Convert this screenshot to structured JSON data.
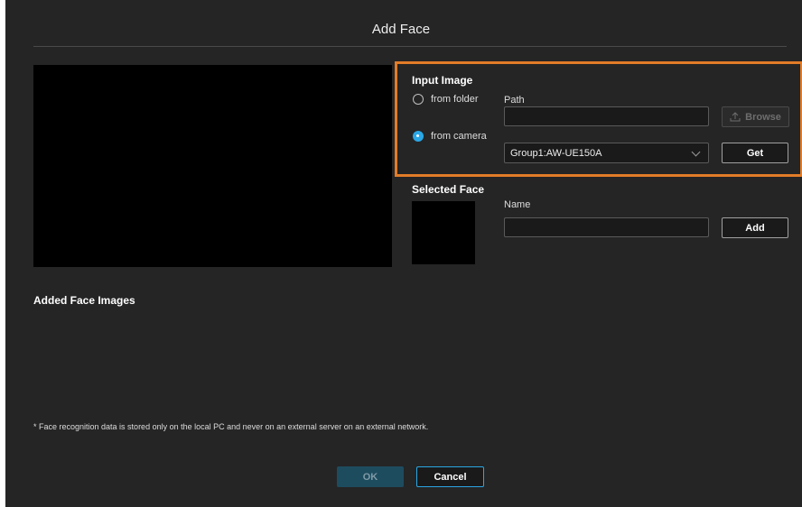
{
  "dialog": {
    "title": "Add Face"
  },
  "input_image": {
    "heading": "Input Image",
    "from_folder_label": "from folder",
    "from_camera_label": "from camera",
    "selected_source": "from camera",
    "path_label": "Path",
    "path_value": "",
    "browse_label": "Browse",
    "camera_value": "Group1:AW-UE150A",
    "get_label": "Get"
  },
  "selected_face": {
    "heading": "Selected Face",
    "name_label": "Name",
    "name_value": "",
    "add_label": "Add"
  },
  "added_images": {
    "heading": "Added Face Images"
  },
  "footer": {
    "note": "* Face recognition data is stored only on the local PC and never on an external server on an external network.",
    "ok_label": "OK",
    "cancel_label": "Cancel"
  },
  "colors": {
    "highlight": "#e27c28",
    "accent": "#2aa7e6",
    "dialog_bg": "#252525"
  }
}
